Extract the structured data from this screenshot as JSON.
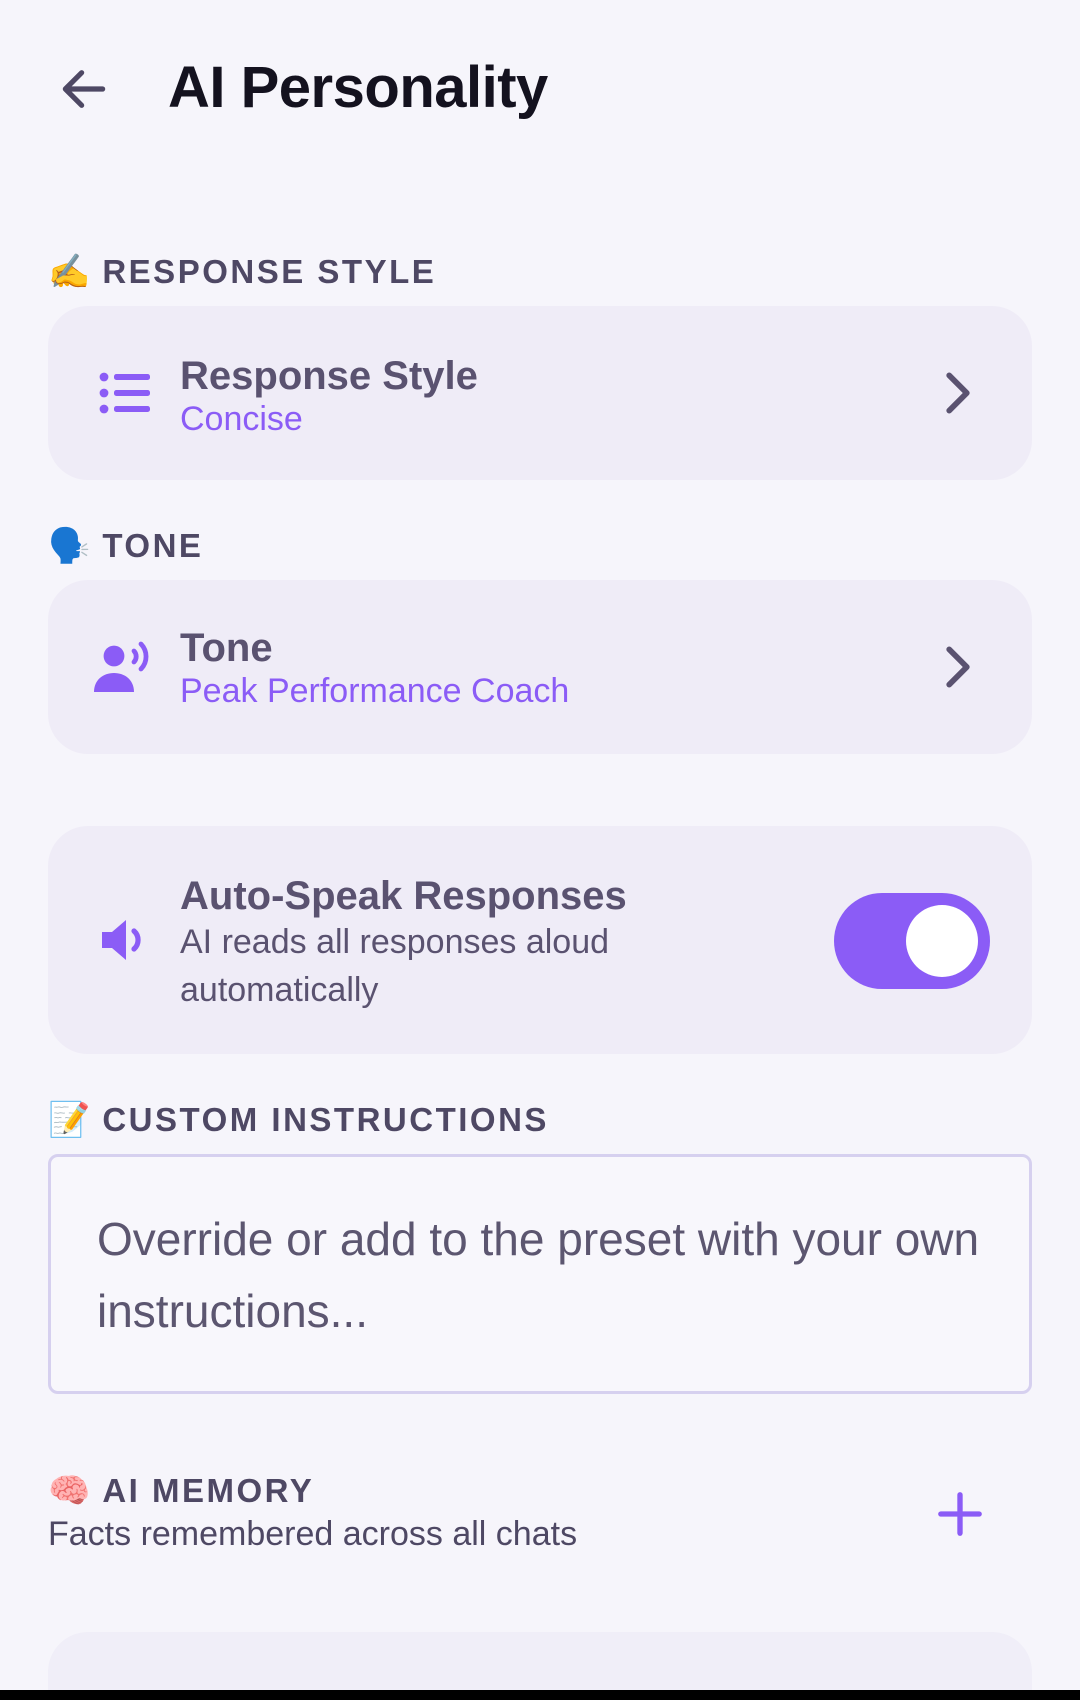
{
  "header": {
    "title": "AI Personality",
    "back_icon": "arrow-left-icon"
  },
  "sections": {
    "response_style": {
      "emoji": "✍️",
      "label": "RESPONSE STYLE"
    },
    "tone": {
      "emoji": "🗣️",
      "label": "TONE"
    },
    "custom_instructions": {
      "emoji": "📝",
      "label": "CUSTOM INSTRUCTIONS"
    },
    "ai_memory": {
      "emoji": "🧠",
      "label": "AI MEMORY",
      "subtitle": "Facts remembered across all chats"
    }
  },
  "response_style_card": {
    "icon": "list-icon",
    "title": "Response Style",
    "value": "Concise"
  },
  "tone_card": {
    "icon": "speaking-person-icon",
    "title": "Tone",
    "value": "Peak Performance Coach"
  },
  "auto_speak_card": {
    "icon": "speaker-icon",
    "title": "Auto-Speak Responses",
    "description": "AI reads all responses aloud automatically",
    "enabled": true
  },
  "custom_instructions": {
    "placeholder": "Override or add to the preset with your own instructions..."
  },
  "colors": {
    "accent": "#8b5cf6",
    "background": "#f6f5fb",
    "card": "#efecf7",
    "text_dark": "#14121f",
    "text_muted": "#4e4864"
  }
}
